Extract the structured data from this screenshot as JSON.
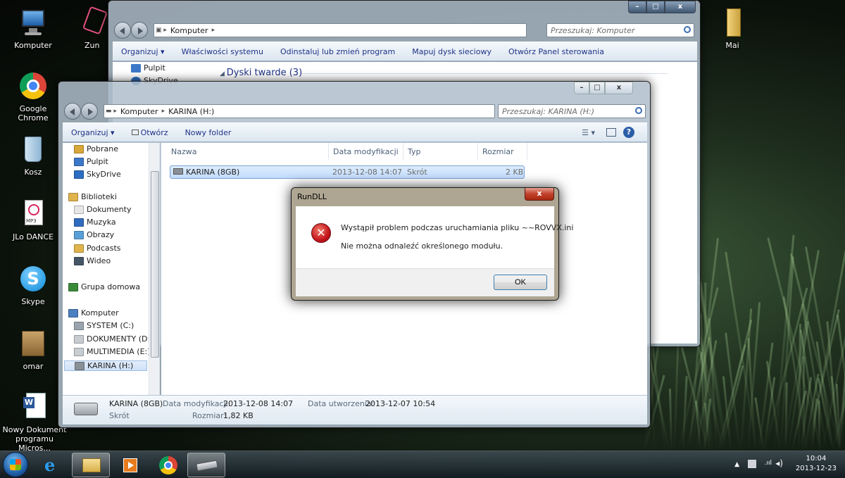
{
  "desktop": {
    "icons": [
      {
        "label": "Komputer"
      },
      {
        "label": "Zun"
      },
      {
        "label": "Google Chrome"
      },
      {
        "label": "Kosz"
      },
      {
        "label": "JLo DANCE"
      },
      {
        "label": "Skype"
      },
      {
        "label": "omar"
      },
      {
        "label": "Nowy Dokument programu Micros..."
      },
      {
        "label": "Mai"
      }
    ]
  },
  "win_komputer": {
    "address": [
      "Komputer"
    ],
    "search_placeholder": "Przeszukaj: Komputer",
    "toolbar": [
      "Organizuj ▾",
      "Właściwości systemu",
      "Odinstaluj lub zmień program",
      "Mapuj dysk sieciowy",
      "Otwórz Panel sterowania"
    ],
    "nav": [
      "Pulpit",
      "SkyDrive"
    ],
    "group_header": "Dyski twarde (3)"
  },
  "win_karina": {
    "address": [
      "Komputer",
      "KARINA (H:)"
    ],
    "search_placeholder": "Przeszukaj: KARINA (H:)",
    "toolbar": [
      "Organizuj ▾",
      "Otwórz",
      "Nowy folder"
    ],
    "nav": [
      {
        "label": "Pobrane",
        "color": "#d8a83a"
      },
      {
        "label": "Pulpit",
        "color": "#3c78c8"
      },
      {
        "label": "SkyDrive",
        "color": "#2d6dc2"
      },
      {
        "label": "Biblioteki",
        "color": "#e0b44c"
      },
      {
        "label": "Dokumenty",
        "color": "#e6e6e6"
      },
      {
        "label": "Muzyka",
        "color": "#2f6bbf"
      },
      {
        "label": "Obrazy",
        "color": "#5aa0d8"
      },
      {
        "label": "Podcasts",
        "color": "#e0b44c"
      },
      {
        "label": "Wideo",
        "color": "#445566"
      },
      {
        "label": "Grupa domowa",
        "color": "#3a8a3a"
      },
      {
        "label": "Komputer",
        "color": "#4a7fc0"
      },
      {
        "label": "SYSTEM (C:)",
        "color": "#9aa4ae"
      },
      {
        "label": "DOKUMENTY (D:",
        "color": "#c8cdd2"
      },
      {
        "label": "MULTIMEDIA (E:)",
        "color": "#c8cdd2"
      },
      {
        "label": "KARINA (H:)",
        "color": "#8a9097"
      }
    ],
    "columns": [
      "Nazwa",
      "Data modyfikacji",
      "Typ",
      "Rozmiar"
    ],
    "rows": [
      {
        "name": "KARINA (8GB)",
        "modified": "2013-12-08 14:07",
        "type": "Skrót",
        "size": "2 KB"
      }
    ],
    "details": {
      "name": "KARINA (8GB)",
      "type": "Skrót",
      "mod_label": "Data modyfikacji:",
      "mod_value": "2013-12-08 14:07",
      "created_label": "Data utworzenia:",
      "created_value": "2013-12-07 10:54",
      "size_label": "Rozmiar:",
      "size_value": "1,82 KB"
    }
  },
  "dialog": {
    "title": "RunDLL",
    "close": "x",
    "line1": "Wystąpił problem podczas uruchamiania pliku ~~ROVVX.ini",
    "line2": "Nie można odnaleźć określonego modułu.",
    "ok": "OK",
    "error_glyph": "✕"
  },
  "taskbar": {
    "time": "10:04",
    "date": "2013-12-23"
  },
  "colors": {
    "accent": "#3c7fb1",
    "error": "#c4161c"
  }
}
